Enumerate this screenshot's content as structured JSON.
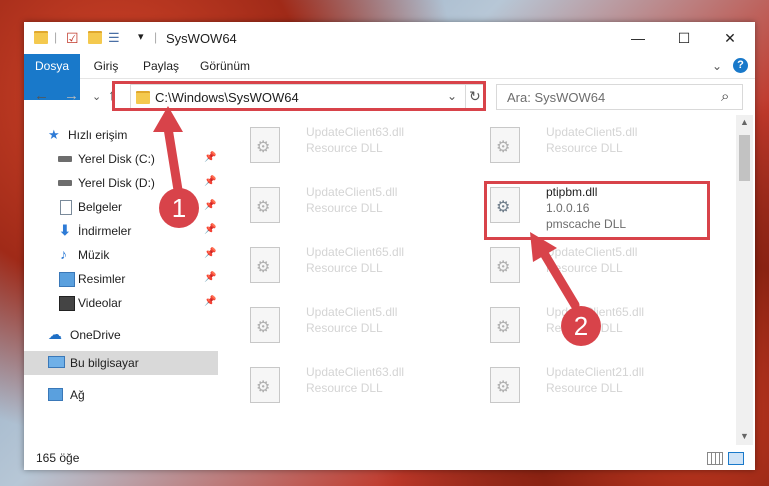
{
  "window": {
    "title": "SysWOW64",
    "controls": {
      "minimize": "—",
      "maximize": "☐",
      "close": "✕"
    }
  },
  "ribbon": {
    "tabs": [
      "Dosya",
      "Giriş",
      "Paylaş",
      "Görünüm"
    ],
    "expand": "⌄",
    "help": "?"
  },
  "navigation": {
    "back": "←",
    "forward": "→",
    "recent": "⌄",
    "up": "↑",
    "address": "C:\\Windows\\SysWOW64",
    "address_dropdown": "⌄",
    "refresh": "↻",
    "search_placeholder": "Ara: SysWOW64",
    "search_icon": "⌕"
  },
  "sidebar": {
    "items": [
      {
        "label": "Hızlı erişim",
        "icon": "star-icon",
        "pinned": false
      },
      {
        "label": "Yerel Disk (C:)",
        "icon": "drive-icon",
        "pinned": true
      },
      {
        "label": "Yerel Disk (D:)",
        "icon": "drive-icon",
        "pinned": true
      },
      {
        "label": "Belgeler",
        "icon": "documents-icon",
        "pinned": true
      },
      {
        "label": "İndirmeler",
        "icon": "download-icon",
        "pinned": true
      },
      {
        "label": "Müzik",
        "icon": "music-icon",
        "pinned": true
      },
      {
        "label": "Resimler",
        "icon": "pictures-icon",
        "pinned": true
      },
      {
        "label": "Videolar",
        "icon": "video-icon",
        "pinned": true
      },
      {
        "label": "OneDrive",
        "icon": "cloud-icon",
        "pinned": false
      },
      {
        "label": "Bu bilgisayar",
        "icon": "computer-icon",
        "pinned": false,
        "selected": true
      },
      {
        "label": "Ağ",
        "icon": "network-icon",
        "pinned": false
      }
    ]
  },
  "files": [
    {
      "name": "UpdateClient63.dll",
      "desc": "Resource DLL"
    },
    {
      "name": "UpdateClient5.dll",
      "desc": "Resource DLL"
    },
    {
      "name": "UpdateClient5.dll",
      "desc": "Resource DLL"
    },
    {
      "name": "ptipbm.dll",
      "version": "1.0.0.16",
      "desc": "pmscache DLL",
      "active": true
    },
    {
      "name": "UpdateClient65.dll",
      "desc": "Resource DLL"
    },
    {
      "name": "UpdateClient5.dll",
      "desc": "Resource DLL"
    },
    {
      "name": "UpdateClient5.dll",
      "desc": "Resource DLL"
    },
    {
      "name": "UpdateClient65.dll",
      "desc": "Resource DLL"
    },
    {
      "name": "UpdateClient63.dll",
      "desc": "Resource DLL"
    },
    {
      "name": "UpdateClient21.dll",
      "desc": "Resource DLL"
    }
  ],
  "status": {
    "count": "165 öğe"
  },
  "annotations": {
    "step1": "1",
    "step2": "2",
    "color": "#d8434a"
  }
}
